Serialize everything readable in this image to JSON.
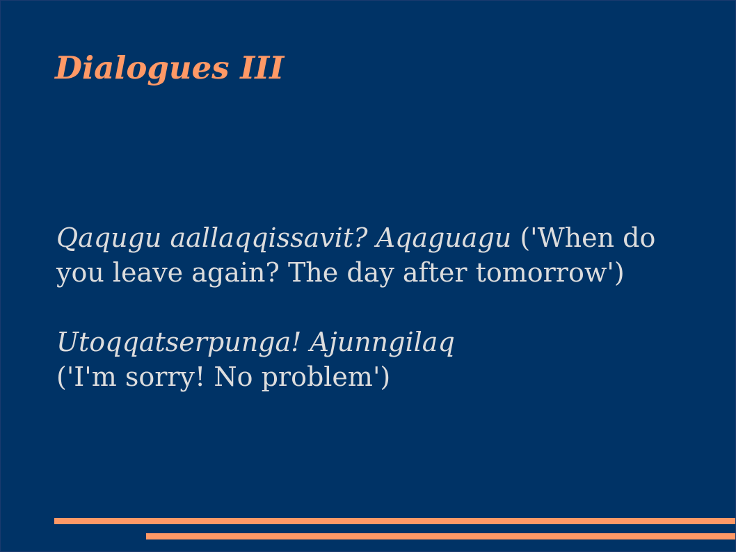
{
  "slide": {
    "title": "Dialogues III",
    "dialogues": [
      {
        "inuktitut": "Qaqugu aallaqqissavit? Aqaguagu",
        "translation": " ('When do you leave again? The day after tomorrow')"
      },
      {
        "inuktitut": "Utoqqatserpunga! Ajunngilaq",
        "translation": "('I'm sorry! No problem')"
      }
    ]
  },
  "colors": {
    "background": "#003366",
    "title": "#ff9966",
    "body_text": "#dddddd",
    "accent_bars": "#ff9966"
  }
}
